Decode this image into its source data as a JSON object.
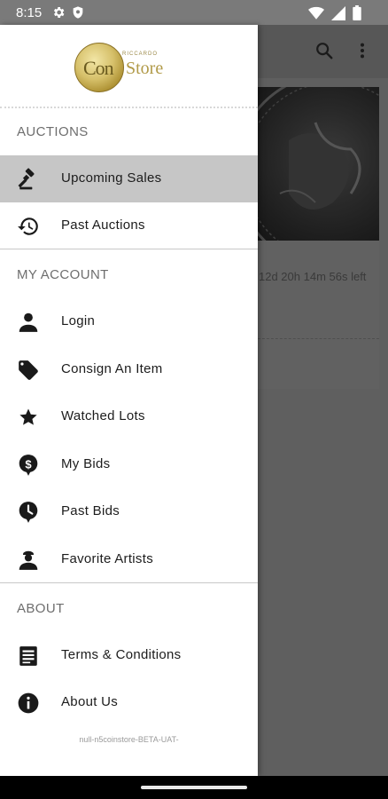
{
  "status_bar": {
    "time": "8:15",
    "left_icons": [
      "gear-icon",
      "shield-icon"
    ],
    "right_icons": [
      "wifi-icon",
      "signal-icon",
      "battery-icon"
    ]
  },
  "logo": {
    "pre_text": "RICCARDO",
    "text_con": "Con",
    "text_store": "Store"
  },
  "background": {
    "card_time_left": "12d 20h 14m 56s left"
  },
  "drawer": {
    "sections": [
      {
        "title": "AUCTIONS",
        "items": [
          {
            "label": "Upcoming Sales",
            "icon": "gavel-icon",
            "active": true
          },
          {
            "label": "Past Auctions",
            "icon": "history-icon",
            "active": false
          }
        ]
      },
      {
        "title": "MY ACCOUNT",
        "items": [
          {
            "label": "Login",
            "icon": "person-icon"
          },
          {
            "label": "Consign An Item",
            "icon": "tag-icon"
          },
          {
            "label": "Watched Lots",
            "icon": "star-icon"
          },
          {
            "label": "My Bids",
            "icon": "dollar-pin-icon"
          },
          {
            "label": "Past Bids",
            "icon": "clock-pin-icon"
          },
          {
            "label": "Favorite Artists",
            "icon": "artist-icon"
          }
        ]
      },
      {
        "title": "ABOUT",
        "items": [
          {
            "label": "Terms & Conditions",
            "icon": "document-icon"
          },
          {
            "label": "About Us",
            "icon": "info-icon"
          }
        ]
      }
    ],
    "footer": "null-n5coinstore-BETA-UAT-"
  },
  "colors": {
    "drawer_bg": "#ffffff",
    "active_item_bg": "#c6c6c6",
    "scrim": "#5f5f5f",
    "gold": "#b19a48"
  }
}
